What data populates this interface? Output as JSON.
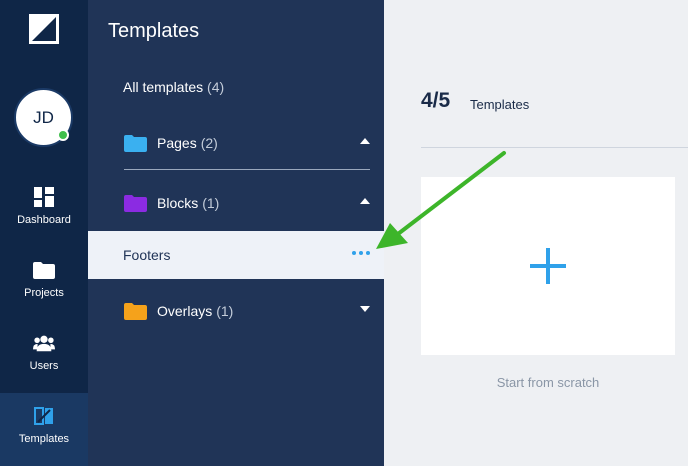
{
  "rail": {
    "avatar_initials": "JD",
    "items": [
      {
        "label": "Dashboard",
        "icon": "dashboard-icon"
      },
      {
        "label": "Projects",
        "icon": "folder-icon"
      },
      {
        "label": "Users",
        "icon": "users-icon"
      },
      {
        "label": "Templates",
        "icon": "templates-icon",
        "active": true
      }
    ]
  },
  "panel": {
    "title": "Templates",
    "all_templates": {
      "label": "All templates",
      "count": "(4)"
    },
    "folders": [
      {
        "label": "Pages",
        "count": "(2)",
        "color": "#3ab0f0",
        "expanded": true
      },
      {
        "label": "Blocks",
        "count": "(1)",
        "color": "#8b2be2",
        "expanded": true
      },
      {
        "label": "Overlays",
        "count": "(1)",
        "color": "#f5a21b",
        "expanded": false
      }
    ],
    "selected_item": {
      "label": "Footers"
    }
  },
  "main": {
    "count": "4/5",
    "count_label": "Templates",
    "scratch_label": "Start from scratch"
  },
  "colors": {
    "accent": "#2fa1ea",
    "annotation_arrow": "#3db52a",
    "rail_bg": "#0f2647",
    "panel_bg": "#203457"
  }
}
